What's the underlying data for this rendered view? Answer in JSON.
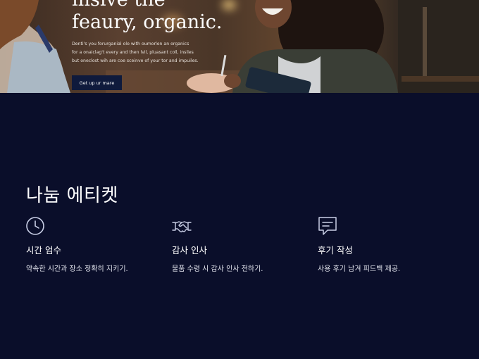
{
  "hero": {
    "title_line1": "insive the",
    "title_line2": "feaury, organic.",
    "desc_line1": "Denti's you forurganial ole with oumorlen an organics",
    "desc_line2": "for a onaiclag't every and then lvil, pluasant coll, insiles",
    "desc_line3": "but oneclost wih are coe sceinve of your tor and impuiles.",
    "button_label": "Get up ur mare"
  },
  "section": {
    "title": "나눔 에티켓",
    "features": [
      {
        "icon": "clock-icon",
        "title": "시간 엄수",
        "desc": "약속한 시간과 장소 정확히 지키기."
      },
      {
        "icon": "handshake-icon",
        "title": "감사 인사",
        "desc": "물품 수령 시 감사 인사 전하기."
      },
      {
        "icon": "message-icon",
        "title": "후기 작성",
        "desc": "사용 후기 남겨 피드백 제공."
      }
    ]
  },
  "colors": {
    "background": "#0a0e2a",
    "button": "#0f1a3c",
    "icon_stroke": "#c9cfe6"
  }
}
